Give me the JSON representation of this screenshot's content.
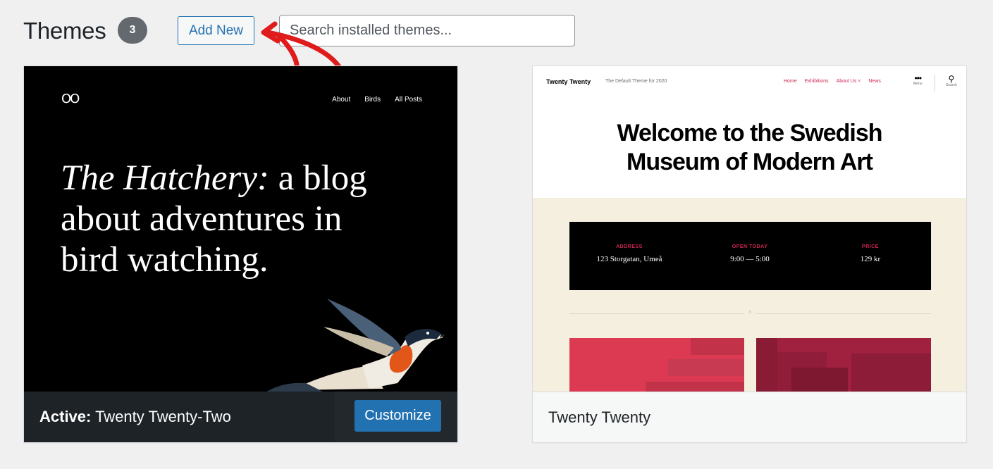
{
  "header": {
    "title": "Themes",
    "count": "3",
    "add_new_label": "Add New",
    "search_placeholder": "Search installed themes..."
  },
  "themes": [
    {
      "active_prefix": "Active:",
      "name": "Twenty Twenty-Two",
      "customize_label": "Customize",
      "preview": {
        "logo": "OO",
        "nav": [
          "About",
          "Birds",
          "All Posts"
        ],
        "headline_italic": "The Hatchery:",
        "headline_rest": " a blog about adventures in bird watching."
      }
    },
    {
      "name": "Twenty Twenty",
      "preview": {
        "site_name": "Twenty Twenty",
        "tagline": "The Default Theme for 2020",
        "menu": [
          "Home",
          "Exhibitions",
          "About Us ˅",
          "News"
        ],
        "menu_icon_label": "Menu",
        "search_icon_label": "Search",
        "title": "Welcome to the Swedish Museum of Modern Art",
        "info": [
          {
            "label": "ADDRESS",
            "value": "123 Storgatan, Umeå"
          },
          {
            "label": "OPEN TODAY",
            "value": "9:00 — 5:00"
          },
          {
            "label": "PRICE",
            "value": "129 kr"
          }
        ],
        "separator_mark": "//"
      }
    }
  ],
  "colors": {
    "accent_blue": "#2271b1",
    "annotation_red": "#e01b1b",
    "tt_accent": "#cd2653"
  },
  "icons": [
    "three-dots-icon",
    "search-icon",
    "annotation-arrow-icon",
    "bird-illustration"
  ]
}
